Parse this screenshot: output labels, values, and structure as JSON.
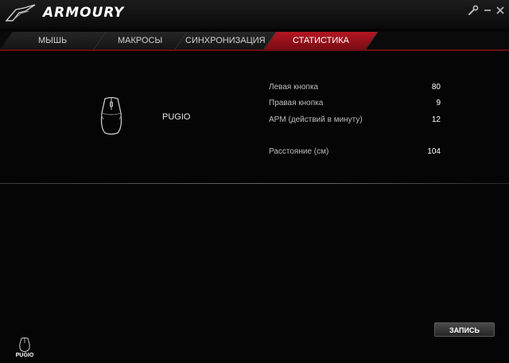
{
  "app": {
    "title": "ARMOURY"
  },
  "colors": {
    "accent": "#b31621",
    "background": "#050505"
  },
  "icons": {
    "logo": "rog-logo-icon",
    "settings": "wrench-icon",
    "minimize": "minimize-icon",
    "close": "close-icon",
    "device": "mouse-icon"
  },
  "tabs": [
    {
      "label": "МЫШЬ",
      "active": false
    },
    {
      "label": "МАКРОСЫ",
      "active": false
    },
    {
      "label": "СИНХРОНИЗАЦИЯ",
      "active": false
    },
    {
      "label": "СТАТИСТИКА",
      "active": true
    }
  ],
  "device": {
    "name": "PUGIO"
  },
  "stats": [
    {
      "label": "Левая кнопка",
      "value": "80"
    },
    {
      "label": "Правая кнопка",
      "value": "9"
    },
    {
      "label": "APM (действий в минуту)",
      "value": "12"
    },
    {
      "label": "Расстояние (см)",
      "value": "104"
    }
  ],
  "actions": {
    "save_label": "ЗАПИСЬ"
  },
  "footer": {
    "device_label": "PUGIO"
  }
}
